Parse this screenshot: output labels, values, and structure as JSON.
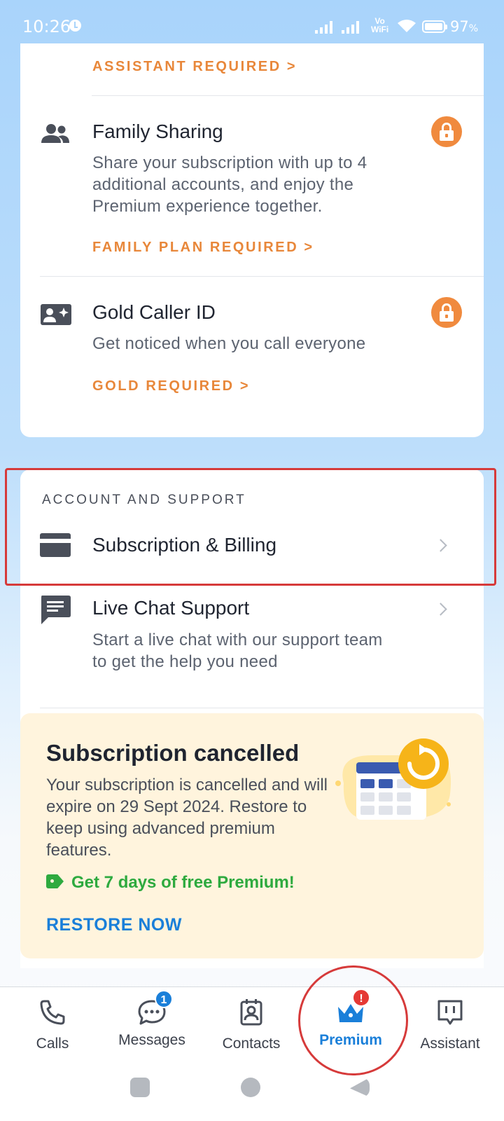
{
  "status_bar": {
    "time": "10:26",
    "network_label_top": "Vo",
    "network_label_bottom": "WiFi",
    "battery_percent": "97",
    "battery_unit": "%"
  },
  "features": {
    "assistant_required": "ASSISTANT REQUIRED >",
    "family_sharing": {
      "title": "Family Sharing",
      "description": "Share your subscription with up to 4 additional accounts, and enjoy the Premium experience together.",
      "cta": "FAMILY PLAN REQUIRED >",
      "icon": "group-icon"
    },
    "gold_caller_id": {
      "title": "Gold Caller ID",
      "description": "Get noticed when you call everyone",
      "cta": "GOLD REQUIRED >",
      "icon": "contact-card-sparkle-icon"
    }
  },
  "account_support": {
    "header": "ACCOUNT AND SUPPORT",
    "subscription_billing": "Subscription & Billing",
    "live_chat": {
      "title": "Live Chat Support",
      "description": "Start a live chat with our support team to get the help you need"
    }
  },
  "promo": {
    "title": "Subscription cancelled",
    "description": "Your subscription is cancelled and will expire on 29 Sept 2024. Restore to keep using advanced premium features.",
    "offer": "Get 7 days of free Premium!",
    "cta": "RESTORE NOW"
  },
  "bottom_nav": {
    "items": [
      {
        "label": "Calls",
        "icon": "phone-icon"
      },
      {
        "label": "Messages",
        "icon": "chat-bubble-icon",
        "badge": "1"
      },
      {
        "label": "Contacts",
        "icon": "contact-book-icon"
      },
      {
        "label": "Premium",
        "icon": "crown-icon",
        "badge": "!",
        "active": true
      },
      {
        "label": "Assistant",
        "icon": "assistant-icon"
      }
    ]
  },
  "colors": {
    "accent_orange": "#e8873a",
    "accent_blue": "#1a7fd9",
    "offer_green": "#2eaa3f",
    "annotation_red": "#d63a3a"
  }
}
